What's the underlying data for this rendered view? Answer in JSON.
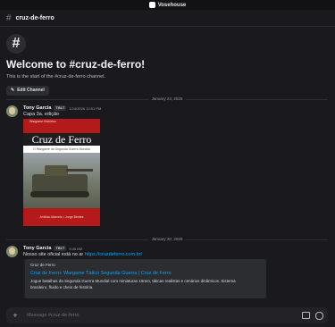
{
  "window": {
    "title": "Vosehouse"
  },
  "channel": {
    "name": "cruz-de-ferro"
  },
  "welcome": {
    "title": "Welcome to #cruz-de-ferro!",
    "subtitle": "This is the start of the #cruz-de-ferro channel.",
    "edit_label": "Edit Channel"
  },
  "dividers": [
    "January 24, 2026",
    "January 30, 2026"
  ],
  "messages": [
    {
      "author": "Tony Garcia",
      "tag": "TBLT",
      "timestamp": "1/24/2026 10:51 PM",
      "text": "Capa 3a. edição",
      "attachment": {
        "series": "Wargame Histórico",
        "title": "Cruz de Ferro",
        "subtitle": "O Wargame da Segunda Guerra Mundial",
        "authors": "Antônio Marcelo • Jorge Bentes"
      }
    },
    {
      "author": "Tony Garcia",
      "tag": "TBLT",
      "timestamp": "9:46 AM",
      "text_prefix": "Nosso site oficial está no ar ",
      "link": "https://cruzdeferro.com.br/",
      "embed": {
        "provider": "Cruz de Ferro",
        "title": "Cruz de Ferro: Wargame Tático Segunda Guerra | Cruz de Ferro",
        "description": "Jogue batalhas da Segunda Guerra Mundial com miniaturas 15mm, táticas realistas e cenários dinâmicos. Sistema brasileiro, fluido e cheio de história."
      }
    }
  ],
  "composer": {
    "placeholder": "Message #cruz-de-ferro"
  },
  "colors": {
    "background": "#1a1a1e",
    "link": "#00a8fc",
    "cover_red": "#b51a1a"
  }
}
